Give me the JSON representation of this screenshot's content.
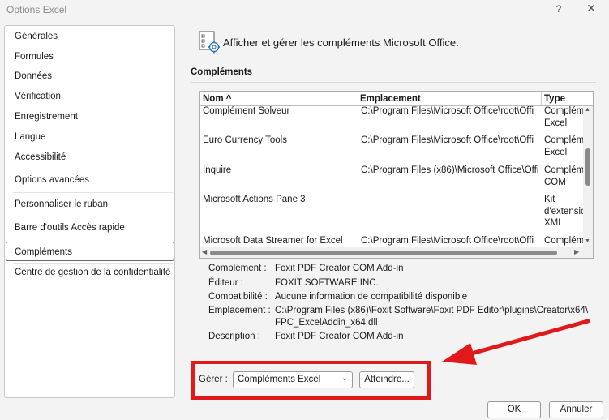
{
  "window": {
    "title": "Options Excel",
    "help": "?",
    "close": "✕"
  },
  "sidebar": {
    "items": [
      {
        "label": "Générales"
      },
      {
        "label": "Formules"
      },
      {
        "label": "Données"
      },
      {
        "label": "Vérification"
      },
      {
        "label": "Enregistrement"
      },
      {
        "label": "Langue"
      },
      {
        "label": "Accessibilité"
      },
      {
        "label": "Options avancées"
      },
      {
        "label": "Personnaliser le ruban"
      },
      {
        "label": "Barre d'outils Accès rapide"
      },
      {
        "label": "Compléments"
      },
      {
        "label": "Centre de gestion de la confidentialité"
      }
    ],
    "selected": "Compléments"
  },
  "header": {
    "text": "Afficher et gérer les compléments Microsoft Office.",
    "icon": "addins-gear-icon"
  },
  "section": {
    "title": "Compléments"
  },
  "table": {
    "columns": [
      "Nom ^",
      "Emplacement",
      "Type"
    ],
    "rows": [
      {
        "name": "Complément Solveur",
        "location": "C:\\Program Files\\Microsoft Office\\root\\Offi",
        "type": "Complém Excel"
      },
      {
        "name": "Euro Currency Tools",
        "location": "C:\\Program Files\\Microsoft Office\\root\\Offi",
        "type": "Complém Excel"
      },
      {
        "name": "Inquire",
        "location": "C:\\Program Files (x86)\\Microsoft Office\\Offi",
        "type": "Complém COM"
      },
      {
        "name": "Microsoft Actions Pane 3",
        "location": "",
        "type": "Kit d'extensic XML"
      },
      {
        "name": "Microsoft Data Streamer for Excel",
        "location": "C:\\Program Files\\Microsoft Office\\root\\Offi",
        "type": "Complém"
      }
    ]
  },
  "details": {
    "complement_label": "Complément :",
    "complement_value": "Foxit PDF Creator COM Add-in",
    "editor_label": "Éditeur :",
    "editor_value": "FOXIT SOFTWARE INC.",
    "compat_label": "Compatibilité :",
    "compat_value": "Aucune information de compatibilité disponible",
    "location_label": "Emplacement :",
    "location_value_1": "C:\\Program Files (x86)\\Foxit Software\\Foxit PDF Editor\\plugins\\Creator\\x64\\",
    "location_value_2": "FPC_ExcelAddin_x64.dll",
    "description_label": "Description :",
    "description_value": "Foxit PDF Creator COM Add-in"
  },
  "manage": {
    "label": "Gérer :",
    "selected": "Compléments Excel",
    "go_button": "Atteindre..."
  },
  "footer": {
    "ok": "OK",
    "cancel": "Annuler"
  },
  "colors": {
    "highlight": "#e0191b"
  }
}
